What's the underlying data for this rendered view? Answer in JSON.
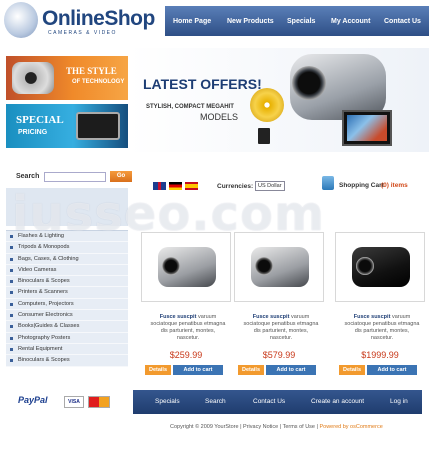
{
  "header": {
    "logo_text": "OnlineShop",
    "logo_sub": "CAMERAS & VIDEO",
    "nav": [
      "Home Page",
      "New Products",
      "Specials",
      "My Account",
      "Contact Us"
    ]
  },
  "banner": {
    "promo1_line1": "THE STYLE",
    "promo1_line2": "OF TECHNOLOGY",
    "promo2_line1": "SPECIAL",
    "promo2_line2": "PRICING",
    "headline": "LATEST OFFERS!",
    "subline": "STYLISH, COMPACT MEGAHIT",
    "models": "MODELS"
  },
  "sidebar": {
    "search_label": "Search",
    "go_label": "Go",
    "category_header": "",
    "categories": [
      "Flashes & Lighting",
      "Tripods & Monopods",
      "Bags, Cases, & Clothing",
      "Video Cameras",
      "Binoculars & Scopes",
      "Printers & Scanners",
      "Computers, Projectors",
      "Consumer Electronics",
      "Books|Guides & Classes",
      "Photography Posters",
      "Rental Equipment",
      "Binoculars & Scopes"
    ]
  },
  "toolbar": {
    "currency_label": "Currencies:",
    "currency_value": "US Dollar",
    "cart_label": "Shopping Cart",
    "cart_count": "(0) items"
  },
  "products": [
    {
      "title_bold": "Fusce suscpit",
      "title_rest": "varuum sociatoque penatibus etmagna dis parturient, montes, nascetur.",
      "price": "$259.99",
      "details": "Details",
      "add": "Add to cart"
    },
    {
      "title_bold": "Fusce suscpit",
      "title_rest": "varuum sociatoque penatibus etmagna dis parturient, montes, nascetur.",
      "price": "$579.99",
      "details": "Details",
      "add": "Add to cart"
    },
    {
      "title_bold": "Fusce suscpit",
      "title_rest": "varuum sociatoque penatibus etmagna dis parturient, montes, nascetur.",
      "price": "$1999.99",
      "details": "Details",
      "add": "Add to cart"
    }
  ],
  "footer": {
    "nav": [
      "Specials",
      "Search",
      "Contact Us",
      "Create an account",
      "Log in"
    ],
    "copyright": "Copyright © 2009 YourStore | Privacy Notice | Terms of Use |",
    "powered": "Powered by osCommerce"
  },
  "partners": {
    "paypal": "PayPal",
    "visa": "VISA"
  },
  "watermark": "iusseo.com",
  "colors": {
    "accent": "#f08a2a",
    "brand": "#21467f",
    "price": "#c8391a"
  }
}
